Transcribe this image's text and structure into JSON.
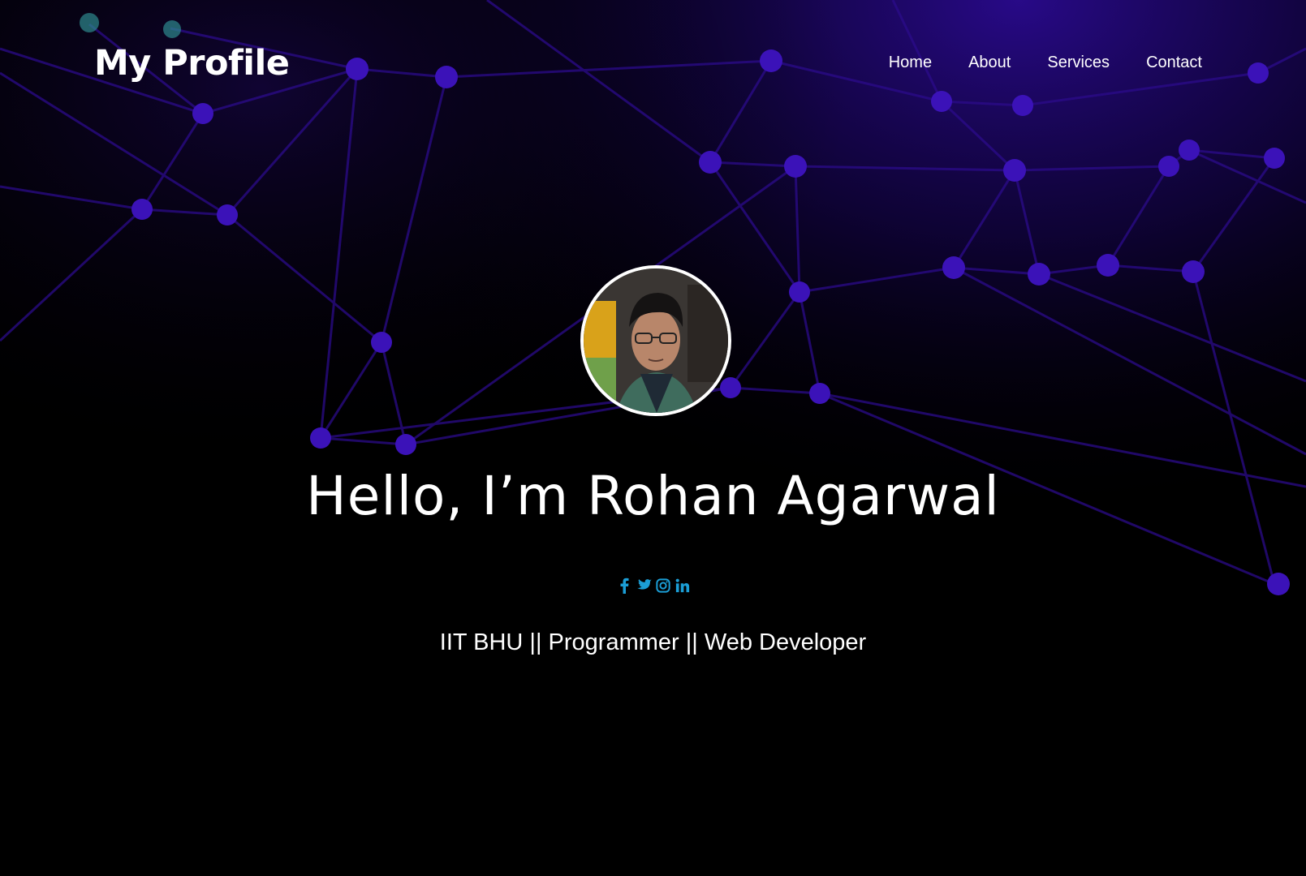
{
  "header": {
    "brand": "My Profile",
    "nav": [
      "Home",
      "About",
      "Services",
      "Contact"
    ]
  },
  "hero": {
    "title": "Hello, I’m Rohan Agarwal",
    "tagline": "IIT BHU || Programmer || Web Developer",
    "avatar_alt": "profile photo"
  },
  "socials": [
    {
      "icon": "facebook-icon",
      "glyph": "f"
    },
    {
      "icon": "twitter-icon",
      "glyph": "t"
    },
    {
      "icon": "instagram-icon",
      "glyph": "ig"
    },
    {
      "icon": "linkedin-icon",
      "glyph": "in"
    }
  ],
  "colors": {
    "background": "#000000",
    "network": "#2a0a8c",
    "node": "#3b12b8",
    "social_accent": "#1b9ed6",
    "text": "#ffffff"
  }
}
